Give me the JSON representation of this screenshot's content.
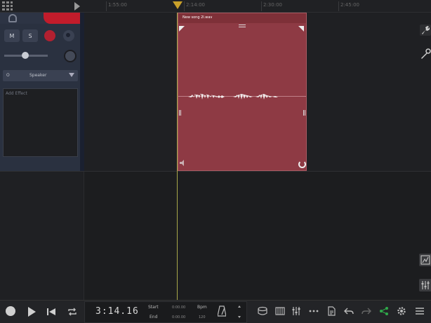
{
  "ruler": {
    "labels": [
      "1:55:00",
      "2:14:00",
      "2:30:00",
      "2:45:00"
    ]
  },
  "track": {
    "mute_label": "M",
    "solo_label": "S",
    "output_prefix": "O",
    "output_label": "Speaker",
    "effects_placeholder": "Add Effect"
  },
  "clip": {
    "title": "New song  2l.wav",
    "color": "#8e3a44"
  },
  "transport": {
    "time": "3:14.16",
    "start_label": "Start",
    "start_value": "0:00.00",
    "end_label": "End",
    "end_value": "0:00.00",
    "bpm_label": "Bpm",
    "bpm_value": "120"
  },
  "icons": {
    "toolbar": [
      "drum-icon",
      "piano-icon",
      "mixer-icon",
      "dots-icon",
      "document-icon",
      "undo-icon",
      "redo-icon",
      "share-icon",
      "settings-icon",
      "menu-icon"
    ]
  },
  "colors": {
    "accent_red": "#c21c2b",
    "playhead": "#c9a02a",
    "share_green": "#2faa4a"
  }
}
